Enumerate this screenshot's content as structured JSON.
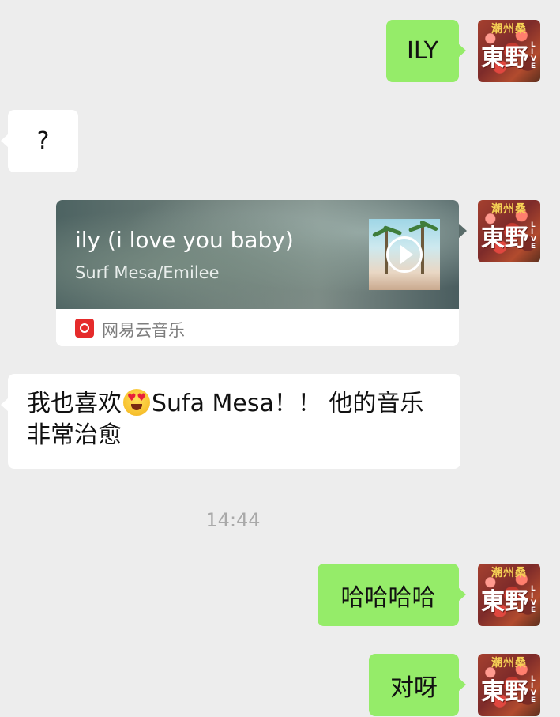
{
  "messages": [
    {
      "id": "m1",
      "side": "right",
      "type": "text",
      "text": "ILY"
    },
    {
      "id": "m2",
      "side": "left",
      "type": "text",
      "text": "?"
    },
    {
      "id": "m3",
      "side": "right",
      "type": "music",
      "title": "ily (i love you baby)",
      "artist": "Surf Mesa/Emilee",
      "source": "网易云音乐"
    },
    {
      "id": "m4",
      "side": "left",
      "type": "text",
      "text_before_emoji": "我也喜欢",
      "emoji": "heart-eyes-emoji",
      "text_after_emoji": "Sufa Mesa！！ 他的音乐非常治愈"
    },
    {
      "id": "m5",
      "side": "right",
      "type": "text",
      "text": "哈哈哈哈"
    },
    {
      "id": "m6",
      "side": "right",
      "type": "text",
      "text": "对呀"
    }
  ],
  "timestamp": "14:44",
  "avatar": {
    "top_text": "潮州桑",
    "main_text": "東野",
    "side_text": "LIVE"
  },
  "colors": {
    "background": "#ededed",
    "sent_bubble": "#95ec69",
    "received_bubble": "#ffffff",
    "timestamp_text": "#a9a9a9",
    "netease_red": "#e52b2b"
  }
}
